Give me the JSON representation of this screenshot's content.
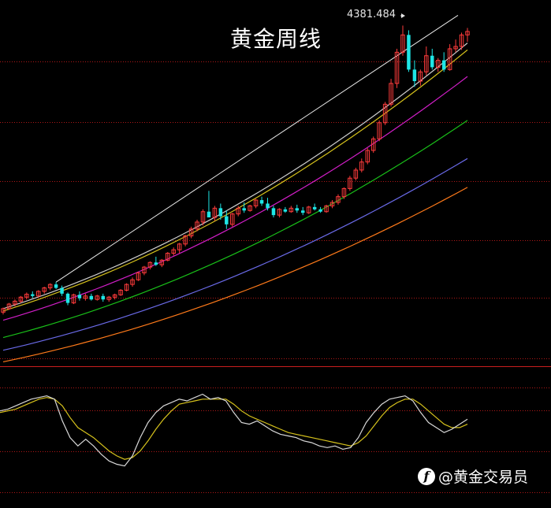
{
  "chart_data": {
    "type": "candlestick",
    "title": "黄金周线",
    "annotation": {
      "label": "4381.484",
      "value": 4381.484
    },
    "main_panel": {
      "ylim": [
        1500,
        4500
      ],
      "candles": [
        [
          1900,
          1940,
          1880,
          1930
        ],
        [
          1930,
          1980,
          1920,
          1970
        ],
        [
          1970,
          2010,
          1950,
          1995
        ],
        [
          1995,
          2040,
          1980,
          2030
        ],
        [
          2030,
          2070,
          2010,
          2055
        ],
        [
          2055,
          2080,
          2020,
          2040
        ],
        [
          2040,
          2090,
          2030,
          2080
        ],
        [
          2080,
          2120,
          2060,
          2110
        ],
        [
          2110,
          2150,
          2090,
          2140
        ],
        [
          2140,
          2160,
          2100,
          2110
        ],
        [
          2110,
          2130,
          2040,
          2060
        ],
        [
          2060,
          2070,
          1960,
          1980
        ],
        [
          1980,
          2060,
          1970,
          2050
        ],
        [
          2050,
          2080,
          2000,
          2020
        ],
        [
          2020,
          2060,
          2000,
          2040
        ],
        [
          2040,
          2060,
          2000,
          2010
        ],
        [
          2010,
          2050,
          2000,
          2040
        ],
        [
          2040,
          2060,
          1990,
          2010
        ],
        [
          2010,
          2040,
          1990,
          2030
        ],
        [
          2030,
          2060,
          2010,
          2050
        ],
        [
          2050,
          2100,
          2040,
          2090
        ],
        [
          2090,
          2150,
          2080,
          2140
        ],
        [
          2140,
          2200,
          2120,
          2180
        ],
        [
          2180,
          2250,
          2170,
          2240
        ],
        [
          2240,
          2300,
          2220,
          2290
        ],
        [
          2290,
          2340,
          2270,
          2330
        ],
        [
          2330,
          2380,
          2300,
          2310
        ],
        [
          2310,
          2360,
          2290,
          2350
        ],
        [
          2350,
          2420,
          2340,
          2410
        ],
        [
          2410,
          2460,
          2390,
          2440
        ],
        [
          2440,
          2500,
          2410,
          2490
        ],
        [
          2490,
          2570,
          2470,
          2560
        ],
        [
          2560,
          2640,
          2540,
          2620
        ],
        [
          2620,
          2700,
          2600,
          2680
        ],
        [
          2680,
          2790,
          2650,
          2770
        ],
        [
          2770,
          2950,
          2740,
          2720
        ],
        [
          2720,
          2820,
          2690,
          2800
        ],
        [
          2800,
          2840,
          2700,
          2730
        ],
        [
          2730,
          2780,
          2620,
          2660
        ],
        [
          2660,
          2760,
          2640,
          2750
        ],
        [
          2750,
          2820,
          2730,
          2800
        ],
        [
          2800,
          2850,
          2760,
          2780
        ],
        [
          2780,
          2830,
          2770,
          2820
        ],
        [
          2820,
          2880,
          2800,
          2870
        ],
        [
          2870,
          2900,
          2820,
          2840
        ],
        [
          2840,
          2890,
          2780,
          2800
        ],
        [
          2800,
          2820,
          2720,
          2740
        ],
        [
          2740,
          2800,
          2720,
          2790
        ],
        [
          2790,
          2810,
          2760,
          2770
        ],
        [
          2770,
          2820,
          2760,
          2800
        ],
        [
          2800,
          2830,
          2760,
          2780
        ],
        [
          2780,
          2810,
          2740,
          2760
        ],
        [
          2760,
          2820,
          2750,
          2810
        ],
        [
          2810,
          2840,
          2780,
          2790
        ],
        [
          2790,
          2810,
          2760,
          2770
        ],
        [
          2770,
          2830,
          2760,
          2820
        ],
        [
          2820,
          2870,
          2800,
          2850
        ],
        [
          2850,
          2920,
          2830,
          2900
        ],
        [
          2900,
          2980,
          2880,
          2970
        ],
        [
          2970,
          3080,
          2950,
          3060
        ],
        [
          3060,
          3150,
          3040,
          3130
        ],
        [
          3130,
          3230,
          3110,
          3200
        ],
        [
          3200,
          3320,
          3180,
          3300
        ],
        [
          3300,
          3420,
          3280,
          3400
        ],
        [
          3400,
          3560,
          3380,
          3540
        ],
        [
          3540,
          3720,
          3520,
          3700
        ],
        [
          3700,
          3920,
          3680,
          3880
        ],
        [
          3880,
          4180,
          3840,
          4150
        ],
        [
          4150,
          4381,
          4120,
          4300
        ],
        [
          4300,
          4340,
          3980,
          4000
        ],
        [
          4000,
          4080,
          3850,
          3900
        ],
        [
          3900,
          4000,
          3860,
          3980
        ],
        [
          3980,
          4200,
          3950,
          4120
        ],
        [
          4120,
          4180,
          4000,
          4020
        ],
        [
          4020,
          4100,
          3980,
          4080
        ],
        [
          4080,
          4150,
          3980,
          4000
        ],
        [
          4000,
          4220,
          3990,
          4180
        ],
        [
          4180,
          4260,
          4150,
          4200
        ],
        [
          4200,
          4320,
          4170,
          4300
        ],
        [
          4300,
          4360,
          4240,
          4330
        ]
      ],
      "ma_lines": [
        {
          "color": "#cfcfcf",
          "start": 1930,
          "end": 4230
        },
        {
          "color": "#d6c21c",
          "start": 1910,
          "end": 4170
        },
        {
          "color": "#d21ec8",
          "start": 1830,
          "end": 3940
        },
        {
          "color": "#19c019",
          "start": 1680,
          "end": 3560
        },
        {
          "color": "#6a6ae8",
          "start": 1570,
          "end": 3230
        },
        {
          "color": "#ff7a1a",
          "start": 1470,
          "end": 2980
        }
      ]
    },
    "oscillator": {
      "ylim": [
        0,
        100
      ],
      "k_line": {
        "color": "#d8d8d8",
        "values": [
          72,
          74,
          78,
          82,
          86,
          88,
          90,
          86,
          60,
          40,
          30,
          38,
          30,
          20,
          12,
          8,
          6,
          18,
          40,
          58,
          70,
          78,
          82,
          86,
          84,
          88,
          92,
          86,
          88,
          84,
          70,
          58,
          56,
          60,
          54,
          48,
          44,
          42,
          40,
          36,
          34,
          30,
          28,
          30,
          26,
          28,
          40,
          58,
          70,
          80,
          86,
          88,
          90,
          84,
          70,
          58,
          52,
          46,
          50,
          56,
          62
        ]
      },
      "d_line": {
        "color": "#d6c21c",
        "values": [
          70,
          72,
          74,
          78,
          82,
          86,
          88,
          86,
          78,
          64,
          52,
          46,
          40,
          32,
          24,
          18,
          14,
          16,
          24,
          36,
          50,
          62,
          72,
          80,
          82,
          84,
          86,
          86,
          86,
          86,
          80,
          72,
          66,
          62,
          58,
          54,
          50,
          46,
          44,
          42,
          40,
          38,
          36,
          34,
          32,
          30,
          34,
          42,
          54,
          66,
          76,
          82,
          86,
          86,
          80,
          72,
          64,
          56,
          52,
          52,
          56
        ]
      }
    }
  },
  "watermark": {
    "logo_glyph": "f",
    "text": "@黄金交易员"
  }
}
